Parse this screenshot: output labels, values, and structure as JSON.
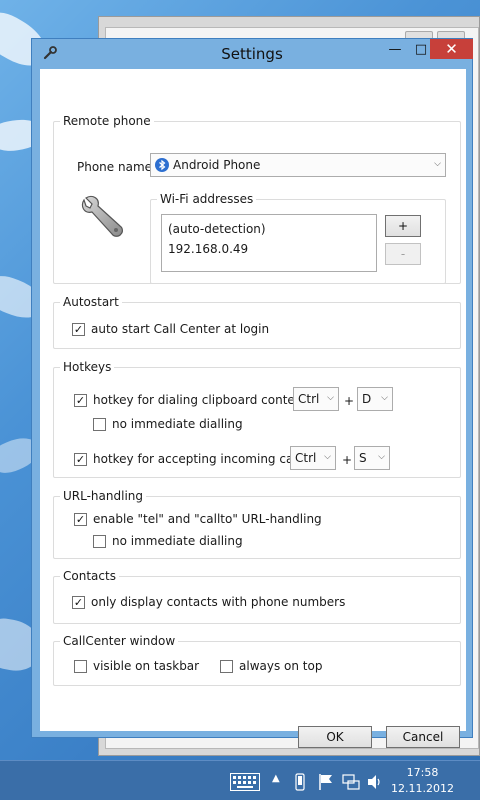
{
  "window": {
    "title": "Settings",
    "minimize": "—",
    "maximize": "□",
    "close": "✕"
  },
  "remote_phone": {
    "legend": "Remote phone",
    "phone_name_label": "Phone name",
    "phone_selected": "Android Phone",
    "wifi_legend": "Wi-Fi addresses",
    "wifi_addresses": [
      "(auto-detection)",
      "192.168.0.49"
    ],
    "add_label": "+",
    "remove_label": "-"
  },
  "autostart": {
    "legend": "Autostart",
    "auto_start_label": "auto start Call Center at login",
    "auto_start_checked": true
  },
  "hotkeys": {
    "legend": "Hotkeys",
    "dial_label": "hotkey for dialing clipboard content",
    "dial_checked": true,
    "dial_modifier": "Ctrl",
    "plus": "+",
    "dial_key": "D",
    "no_immediate_label": "no immediate dialling",
    "no_immediate_checked": false,
    "accept_label": "hotkey for accepting incoming calls",
    "accept_checked": true,
    "accept_modifier": "Ctrl",
    "accept_key": "S"
  },
  "url_handling": {
    "legend": "URL-handling",
    "enable_label": "enable \"tel\" and \"callto\" URL-handling",
    "enable_checked": true,
    "no_immediate_label": "no immediate dialling",
    "no_immediate_checked": false
  },
  "contacts": {
    "legend": "Contacts",
    "only_phone_label": "only display contacts with phone numbers",
    "only_phone_checked": true
  },
  "callcenter_window": {
    "legend": "CallCenter window",
    "visible_taskbar_label": "visible on taskbar",
    "visible_taskbar_checked": false,
    "always_on_top_label": "always on top",
    "always_on_top_checked": false
  },
  "buttons": {
    "ok": "OK",
    "cancel": "Cancel"
  },
  "taskbar": {
    "time": "17:58",
    "date": "12.11.2012"
  },
  "colors": {
    "accent": "#3a6ea8",
    "close_red": "#c7403a",
    "window_frame": "#79b0e0"
  }
}
